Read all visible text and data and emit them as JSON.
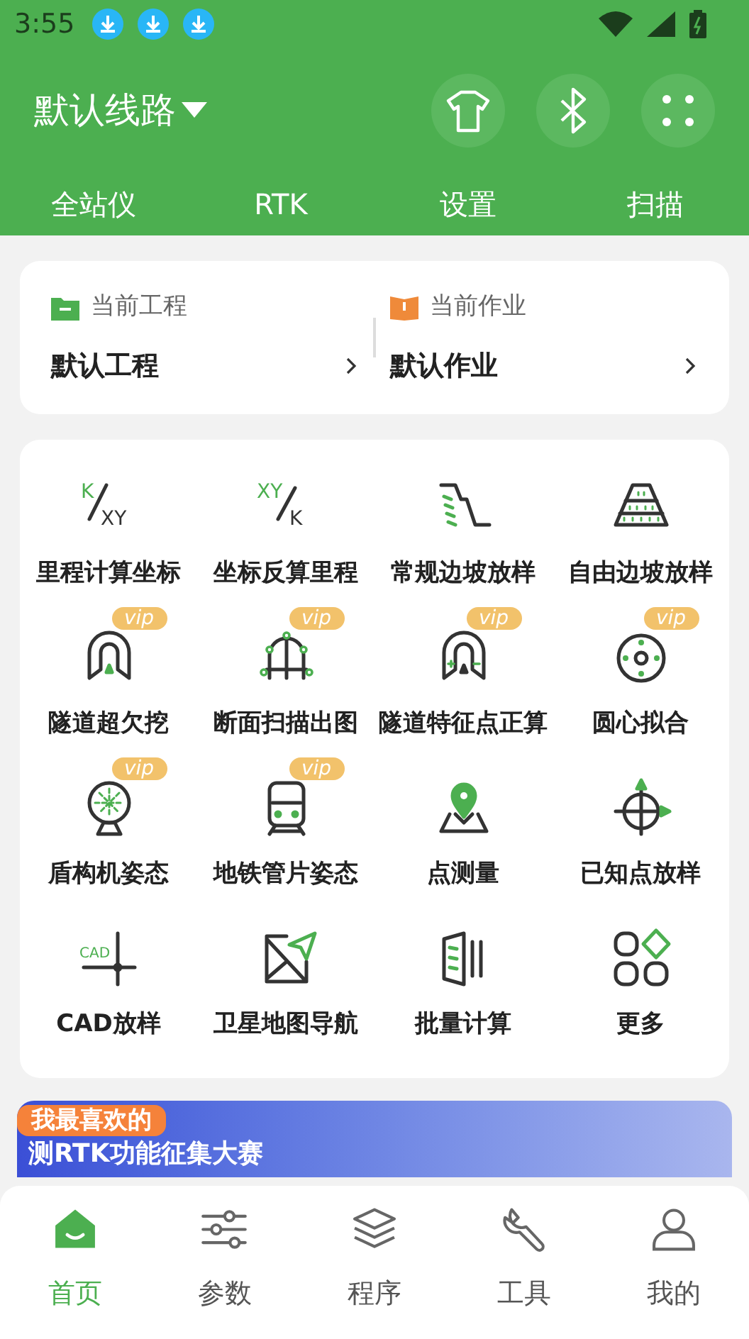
{
  "status_bar": {
    "time": "3:55"
  },
  "header": {
    "title": "默认线路"
  },
  "top_tabs": [
    "全站仪",
    "RTK",
    "设置",
    "扫描"
  ],
  "project_card": [
    {
      "label": "当前工程",
      "value": "默认工程"
    },
    {
      "label": "当前作业",
      "value": "默认作业"
    }
  ],
  "tools": [
    {
      "label": "里程计算坐标",
      "icon_top": "K",
      "icon_bottom": "XY"
    },
    {
      "label": "坐标反算里程",
      "icon_top": "XY",
      "icon_bottom": "K"
    },
    {
      "label": "常规边坡放样"
    },
    {
      "label": "自由边坡放样"
    },
    {
      "label": "隧道超欠挖",
      "badge": "vip"
    },
    {
      "label": "断面扫描出图",
      "badge": "vip"
    },
    {
      "label": "隧道特征点正算",
      "badge": "vip"
    },
    {
      "label": "圆心拟合",
      "badge": "vip"
    },
    {
      "label": "盾构机姿态",
      "badge": "vip"
    },
    {
      "label": "地铁管片姿态",
      "badge": "vip"
    },
    {
      "label": "点测量"
    },
    {
      "label": "已知点放样"
    },
    {
      "label": "CAD放样",
      "icon_text": "CAD"
    },
    {
      "label": "卫星地图导航"
    },
    {
      "label": "批量计算"
    },
    {
      "label": "更多"
    }
  ],
  "banner": {
    "tag": "我最喜欢的",
    "headline": "测RTK功能征集大赛"
  },
  "bottom_nav": [
    {
      "label": "首页",
      "selected": true
    },
    {
      "label": "参数",
      "selected": false
    },
    {
      "label": "程序",
      "selected": false
    },
    {
      "label": "工具",
      "selected": false
    },
    {
      "label": "我的",
      "selected": false
    }
  ]
}
